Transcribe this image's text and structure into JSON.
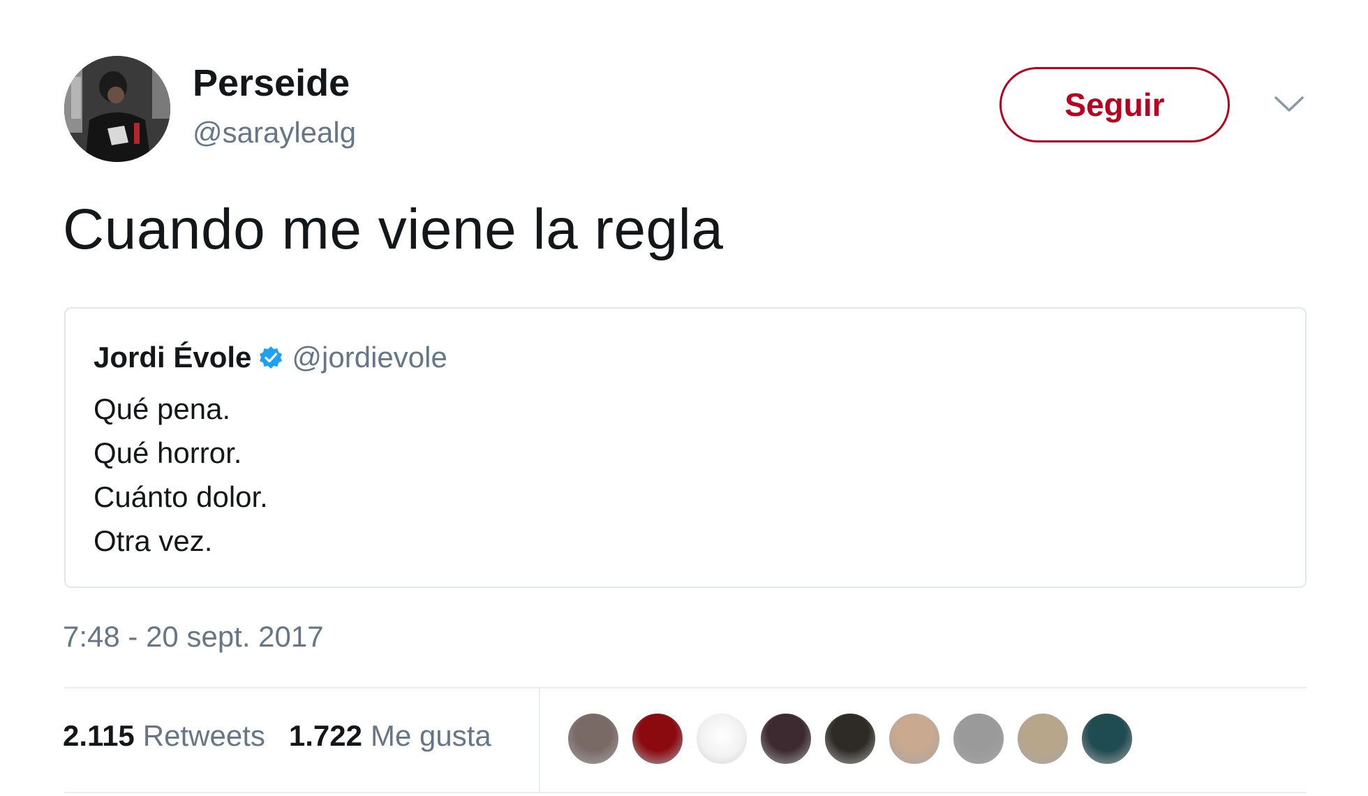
{
  "author": {
    "display_name": "Perseide",
    "handle": "@saraylealg"
  },
  "follow_button": {
    "label": "Seguir"
  },
  "tweet": {
    "text": "Cuando me viene la regla",
    "timestamp": "7:48 - 20 sept. 2017"
  },
  "quoted_tweet": {
    "name": "Jordi Évole",
    "handle": "@jordievole",
    "lines": [
      "Qué pena.",
      "Qué horror.",
      "Cuánto dolor.",
      "Otra vez."
    ]
  },
  "stats": {
    "retweets_count": "2.115",
    "retweets_label": "Retweets",
    "likes_count": "1.722",
    "likes_label": "Me gusta"
  },
  "likers": [
    {
      "color": "#7a6a66"
    },
    {
      "color": "#8a0a10"
    },
    {
      "color": "#efefef"
    },
    {
      "color": "#3c2a30"
    },
    {
      "color": "#2e2a26"
    },
    {
      "color": "#c9a98f"
    },
    {
      "color": "#9a9a9a"
    },
    {
      "color": "#b8a68a"
    },
    {
      "color": "#1f4b52"
    }
  ],
  "colors": {
    "follow_red": "#b8001f",
    "secondary_text": "#657786",
    "verified_blue": "#1da1f2",
    "divider": "#e6ecf0"
  },
  "icons": {
    "caret": "chevron-down-icon",
    "verified": "verified-badge-icon"
  }
}
